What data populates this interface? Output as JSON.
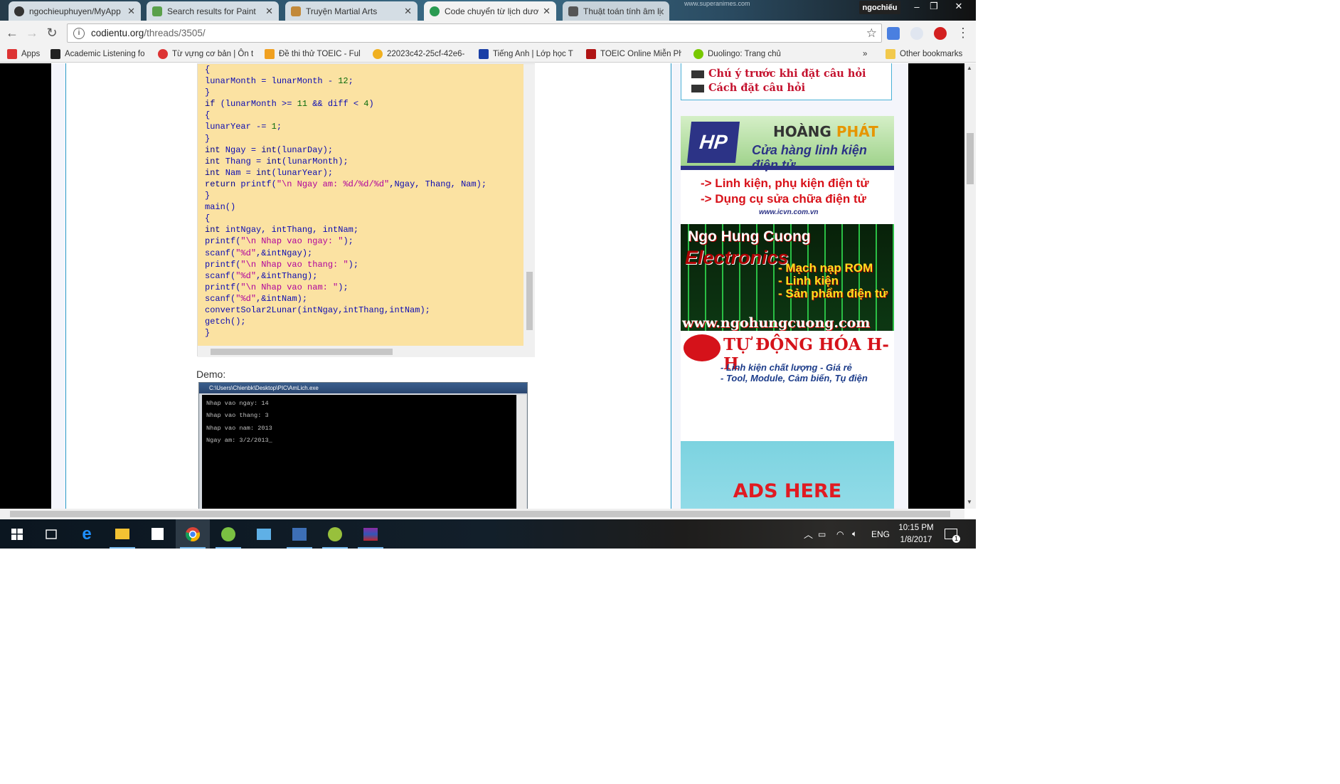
{
  "tabs": [
    {
      "title": "ngochieuphuyen/MyApp",
      "favicon_color": "#333333",
      "active": false
    },
    {
      "title": "Search results for Paint",
      "favicon_color": "#5aa04a",
      "active": false
    },
    {
      "title": "Truyện Martial Arts",
      "favicon_color": "#c2893a",
      "active": false
    },
    {
      "title": "Code chuyển từ lịch dươ",
      "favicon_color": "#2a9b52",
      "active": true
    },
    {
      "title": "Thuật toán tính âm lịch",
      "favicon_color": "#555555",
      "active": false
    }
  ],
  "titlebar": {
    "profile": "ngochiếu",
    "watermark": "www.superanimes.com"
  },
  "toolbar": {
    "url_host": "codientu.org",
    "url_path": "/threads/3505/"
  },
  "bookmarks": [
    {
      "label": "Apps",
      "icon": "apps-grid-icon",
      "color": "#d33"
    },
    {
      "label": "Academic Listening fo",
      "icon": "academic-icon",
      "color": "#222"
    },
    {
      "label": "Từ vựng cơ bản | Ôn t",
      "icon": "target-icon",
      "color": "#d33"
    },
    {
      "label": "Đề thi thử TOEIC - Ful",
      "icon": "toeic-icon",
      "color": "#f0a020"
    },
    {
      "label": "22023c42-25cf-42e6-",
      "icon": "spinner-icon",
      "color": "#f0b020"
    },
    {
      "label": "Tiếng Anh | Lớp học T",
      "icon": "we-icon",
      "color": "#1a3fa6"
    },
    {
      "label": "TOEIC Online Miễn Phí",
      "icon": "24h-icon",
      "color": "#b01414"
    },
    {
      "label": "Duolingo: Trang chủ",
      "icon": "duolingo-icon",
      "color": "#78c800"
    }
  ],
  "other_bookmarks": "Other bookmarks",
  "code_lines": [
    "{",
    "lunarMonth = lunarMonth - 12;",
    "}",
    "if (lunarMonth >= 11 && diff < 4)",
    "{",
    "lunarYear -= 1;",
    "}",
    "int Ngay = int(lunarDay);",
    "int Thang = int(lunarMonth);",
    "int Nam = int(lunarYear);",
    "return printf(\"\\n Ngay am: %d/%d/%d\",Ngay, Thang, Nam);",
    "}",
    "main()",
    "{",
    "int intNgay, intThang, intNam;",
    "printf(\"\\n Nhap vao ngay: \");",
    "scanf(\"%d\",&intNgay);",
    "printf(\"\\n Nhap vao thang: \");",
    "scanf(\"%d\",&intThang);",
    "printf(\"\\n Nhap vao nam: \");",
    "scanf(\"%d\",&intNam);",
    "convertSolar2Lunar(intNgay,intThang,intNam);",
    "getch();",
    "}"
  ],
  "demo_label": "Demo:",
  "console": {
    "title": "C:\\Users\\Chienbk\\Desktop\\PIC\\AmLich.exe",
    "lines": [
      "Nhap vao ngay: 14",
      "Nhap vao thang: 3",
      "Nhap vao nam: 2013",
      "Ngay am: 3/2/2013_"
    ]
  },
  "sidebar": {
    "notice_items": [
      "Chú ý trước khi đặt câu hỏi",
      "Cách đặt câu hỏi"
    ],
    "ad_hoangphat": {
      "logo": "HP",
      "brand_1": "HOÀNG",
      "brand_2": "PHÁT",
      "tagline": "Cửa hàng linh kiện điện tử",
      "line_1": "-> Linh kiện, phụ kiện điện tử",
      "line_2": "-> Dụng cụ sửa chữa điện tử",
      "site": "www.icvn.com.vn"
    },
    "ad_ngohungcuong": {
      "name": "Ngo Hung Cuong",
      "sub": "Electronics",
      "items": [
        "- Mạch nạp ROM",
        "- Linh kiện",
        "- Sản phẩm điện tử"
      ],
      "url": "www.ngohungcuong.com"
    },
    "ad_tudonghoa": {
      "title": "TỰ ĐỘNG HÓA H-H",
      "line_1": "- Linh kiện chất lượng - Giá rẻ",
      "line_2": "- Tool, Module, Cảm biến, Tụ điện"
    },
    "ad_here": "ADS HERE"
  },
  "taskbar": {
    "lang": "ENG",
    "time": "10:15 PM",
    "date": "1/8/2017",
    "notifications": "1"
  }
}
